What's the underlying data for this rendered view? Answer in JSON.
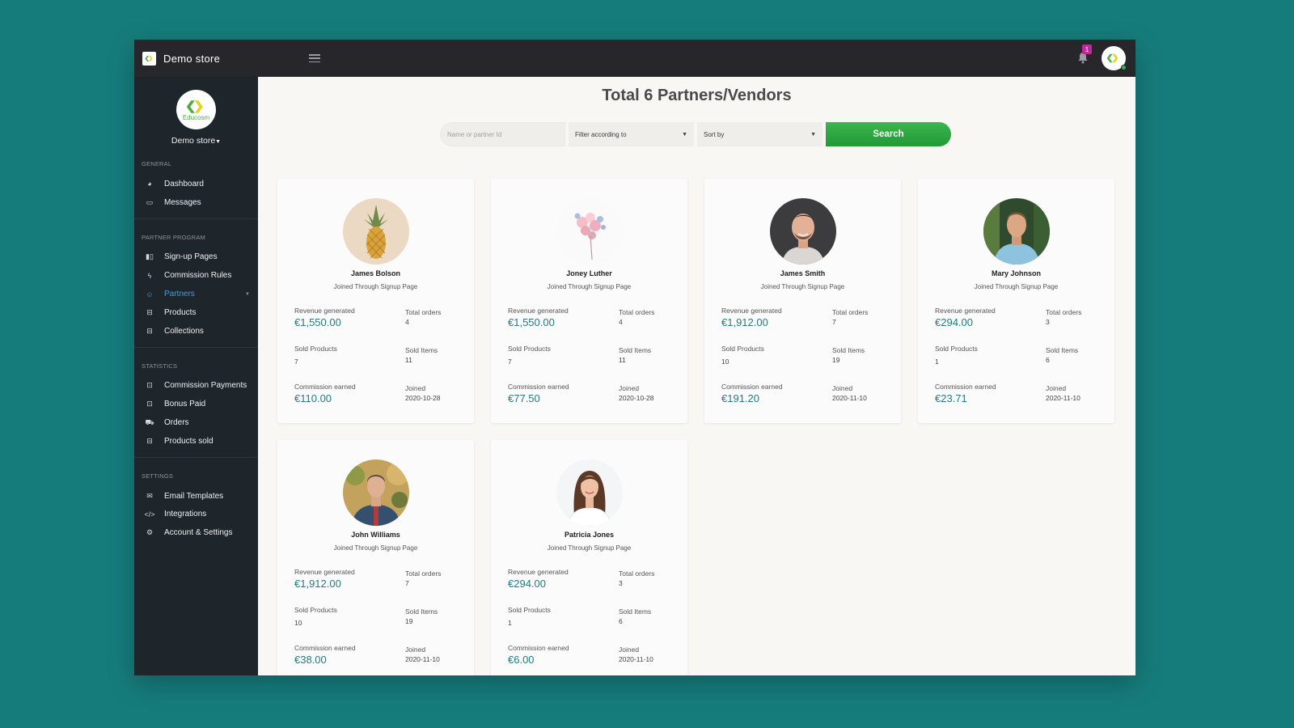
{
  "topbar": {
    "store_name": "Demo store",
    "notification_count": "1"
  },
  "sidebar": {
    "logo_text": "Educosm",
    "store_selector": "Demo store",
    "sections": [
      {
        "title": "GENERAL",
        "items": [
          {
            "label": "Dashboard",
            "icon": "dashboard-icon"
          },
          {
            "label": "Messages",
            "icon": "message-icon"
          }
        ]
      },
      {
        "title": "PARTNER PROGRAM",
        "items": [
          {
            "label": "Sign-up Pages",
            "icon": "pages-icon"
          },
          {
            "label": "Commission Rules",
            "icon": "bolt-icon"
          },
          {
            "label": "Partners",
            "icon": "users-icon",
            "active": true
          },
          {
            "label": "Products",
            "icon": "basket-icon"
          },
          {
            "label": "Collections",
            "icon": "basket-icon"
          }
        ]
      },
      {
        "title": "STATISTICS",
        "items": [
          {
            "label": "Commission Payments",
            "icon": "money-icon"
          },
          {
            "label": "Bonus Paid",
            "icon": "money-icon"
          },
          {
            "label": "Orders",
            "icon": "cart-icon"
          },
          {
            "label": "Products sold",
            "icon": "basket-icon"
          }
        ]
      },
      {
        "title": "SETTINGS",
        "items": [
          {
            "label": "Email Templates",
            "icon": "envelope-icon"
          },
          {
            "label": "Integrations",
            "icon": "code-icon"
          },
          {
            "label": "Account & Settings",
            "icon": "gear-icon"
          }
        ]
      }
    ]
  },
  "main": {
    "title": "Total 6 Partners/Vendors",
    "search_placeholder": "Name or partner Id",
    "filter_label": "Filter according to",
    "sort_label": "Sort by",
    "search_button": "Search",
    "labels": {
      "revenue": "Revenue generated",
      "orders": "Total orders",
      "sold_products": "Sold Products",
      "sold_items": "Sold Items",
      "commission": "Commission earned",
      "joined": "Joined"
    },
    "partners": [
      {
        "name": "James Bolson",
        "source": "Joined Through Signup Page",
        "revenue": "€1,550.00",
        "orders": "4",
        "sold_products": "7",
        "sold_items": "11",
        "commission": "€110.00",
        "joined": "2020-10-28",
        "avatar": "pineapple"
      },
      {
        "name": "Joney Luther",
        "source": "Joined Through Signup Page",
        "revenue": "€1,550.00",
        "orders": "4",
        "sold_products": "7",
        "sold_items": "11",
        "commission": "€77.50",
        "joined": "2020-10-28",
        "avatar": "flowers"
      },
      {
        "name": "James Smith",
        "source": "Joined Through Signup Page",
        "revenue": "€1,912.00",
        "orders": "7",
        "sold_products": "10",
        "sold_items": "19",
        "commission": "€191.20",
        "joined": "2020-11-10",
        "avatar": "man-dark-bg"
      },
      {
        "name": "Mary Johnson",
        "source": "Joined Through Signup Page",
        "revenue": "€294.00",
        "orders": "3",
        "sold_products": "1",
        "sold_items": "6",
        "commission": "€23.71",
        "joined": "2020-11-10",
        "avatar": "man-green-bg"
      },
      {
        "name": "John Williams",
        "source": "Joined Through Signup Page",
        "revenue": "€1,912.00",
        "orders": "7",
        "sold_products": "10",
        "sold_items": "19",
        "commission": "€38.00",
        "joined": "2020-11-10",
        "avatar": "man-autumn-bg"
      },
      {
        "name": "Patricia Jones",
        "source": "Joined Through Signup Page",
        "revenue": "€294.00",
        "orders": "3",
        "sold_products": "1",
        "sold_items": "6",
        "commission": "€6.00",
        "joined": "2020-11-10",
        "avatar": "woman-white-bg"
      }
    ]
  },
  "colors": {
    "background": "#167c7b",
    "topbar": "#27262b",
    "sidebar": "#1f262b",
    "accent_active": "#4b9bd8",
    "money": "#237b82",
    "search_button": "#2aa843",
    "badge": "#c1289e"
  }
}
